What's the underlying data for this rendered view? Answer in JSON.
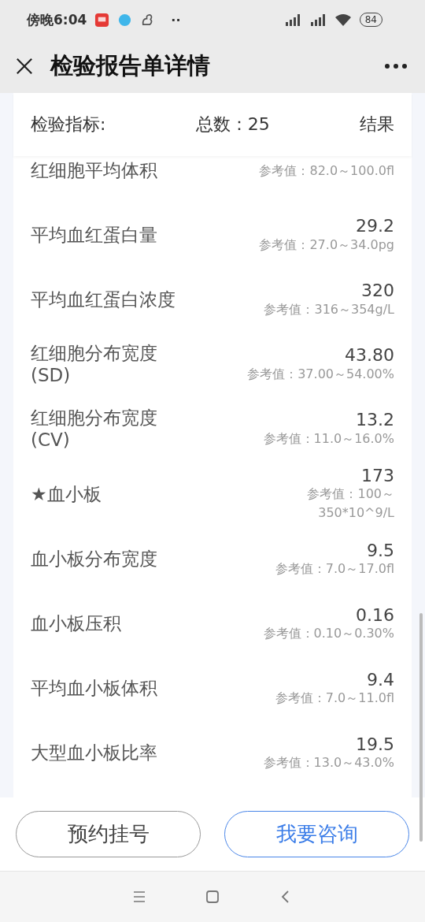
{
  "status_bar": {
    "time": "傍晚6:04",
    "more": "··",
    "battery": "84"
  },
  "title_bar": {
    "title": "检验报告单详情"
  },
  "report": {
    "header": {
      "indicator_label": "检验指标:",
      "total": "总数：25",
      "result_label": "结果"
    },
    "items": [
      {
        "name": "红细胞平均体积",
        "reference": "参考值：82.0～100.0fl",
        "partial": true
      },
      {
        "name": "平均血红蛋白量",
        "value": "29.2",
        "reference": "参考值：27.0～34.0pg",
        "partial": false
      },
      {
        "name": "平均血红蛋白浓度",
        "value": "320",
        "reference": "参考值：316～354g/L",
        "partial": false
      },
      {
        "name": "红细胞分布宽度(SD)",
        "value": "43.80",
        "reference": "参考值：37.00～54.00%",
        "partial": false
      },
      {
        "name": "红细胞分布宽度(CV)",
        "value": "13.2",
        "reference": "参考值：11.0～16.0%",
        "partial": false
      },
      {
        "name": "★血小板",
        "value": "173",
        "reference": "参考值：100～350*10^9/L",
        "partial": false
      },
      {
        "name": "血小板分布宽度",
        "value": "9.5",
        "reference": "参考值：7.0～17.0fl",
        "partial": false
      },
      {
        "name": "血小板压积",
        "value": "0.16",
        "reference": "参考值：0.10～0.30%",
        "partial": false
      },
      {
        "name": "平均血小板体积",
        "value": "9.4",
        "reference": "参考值：7.0～11.0fl",
        "partial": false
      },
      {
        "name": "大型血小板比率",
        "value": "19.5",
        "reference": "参考值：13.0～43.0%",
        "partial": false
      }
    ]
  },
  "buttons": [
    {
      "label": "预约挂号",
      "kind": "secondary"
    },
    {
      "label": "我要咨询",
      "kind": "primary"
    }
  ]
}
